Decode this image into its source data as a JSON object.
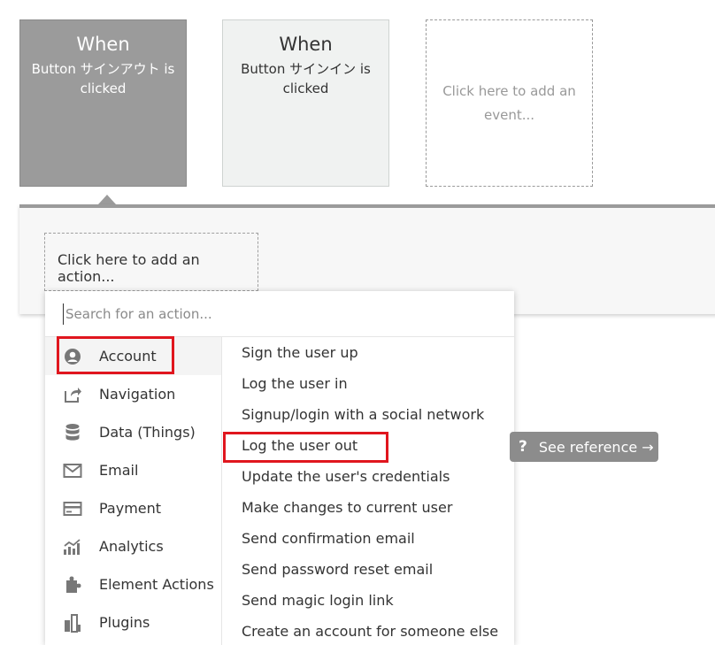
{
  "events": [
    {
      "when": "When",
      "description": "Button サインアウト is clicked"
    },
    {
      "when": "When",
      "description": "Button サインイン is clicked"
    }
  ],
  "add_event_label": "Click here to add an event...",
  "add_action_label": "Click here to add an action...",
  "search": {
    "placeholder": "Search for an action...",
    "value": ""
  },
  "categories": [
    {
      "label": "Account",
      "icon": "account-icon"
    },
    {
      "label": "Navigation",
      "icon": "navigation-icon"
    },
    {
      "label": "Data (Things)",
      "icon": "database-icon"
    },
    {
      "label": "Email",
      "icon": "email-icon"
    },
    {
      "label": "Payment",
      "icon": "credit-card-icon"
    },
    {
      "label": "Analytics",
      "icon": "analytics-icon"
    },
    {
      "label": "Element Actions",
      "icon": "puzzle-icon"
    },
    {
      "label": "Plugins",
      "icon": "plugins-icon"
    }
  ],
  "actions": [
    {
      "label": "Sign the user up"
    },
    {
      "label": "Log the user in"
    },
    {
      "label": "Signup/login with a social network"
    },
    {
      "label": "Log the user out"
    },
    {
      "label": "Update the user's credentials"
    },
    {
      "label": "Make changes to current user"
    },
    {
      "label": "Send confirmation email"
    },
    {
      "label": "Send password reset email"
    },
    {
      "label": "Send magic login link"
    },
    {
      "label": "Create an account for someone else"
    }
  ],
  "see_reference": {
    "icon": "?",
    "label": "See reference →"
  },
  "colors": {
    "selected_event_bg": "#9b9b9b",
    "highlight": "#e0161e",
    "see_reference_bg": "#8c8c8c"
  }
}
